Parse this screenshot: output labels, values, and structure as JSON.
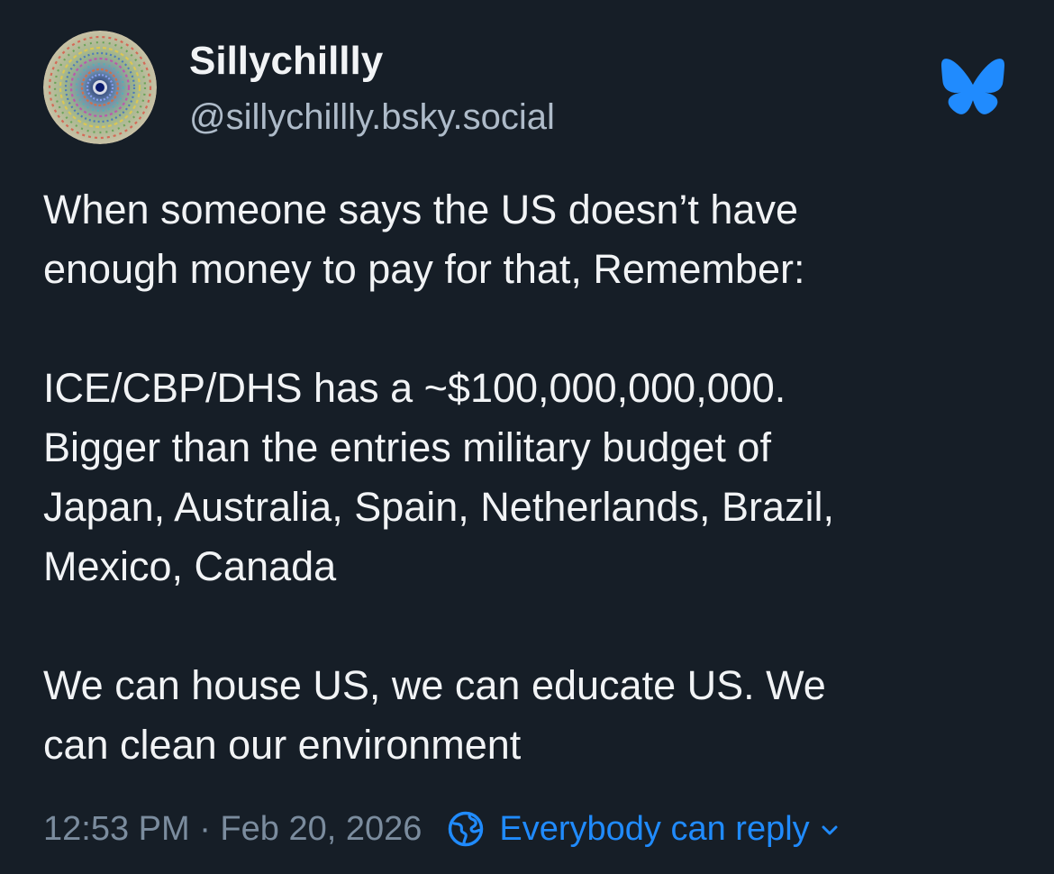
{
  "author": {
    "display_name": "Sillychillly",
    "handle": "@sillychillly.bsky.social",
    "avatar_icon": "swirl-avatar"
  },
  "brand": {
    "logo_icon": "bluesky-butterfly-icon",
    "color": "#208bfe"
  },
  "post": {
    "paragraphs": [
      "When someone says the US doesn’t have\nenough money to pay for that, Remember:",
      "ICE/CBP/DHS has a ~$100,000,000,000.\nBigger than the entries military budget of\nJapan, Australia, Spain, Netherlands, Brazil,\nMexico, Canada",
      "We can house US, we can educate US. We\ncan clean our environment"
    ]
  },
  "meta": {
    "timestamp": "12:53 PM · Feb 20, 2026",
    "reply_setting": "Everybody can reply",
    "reply_icon": "globe-icon"
  },
  "colors": {
    "background": "#161e27",
    "text": "#f1f3f5",
    "secondary_text": "#aebbc9",
    "muted_text": "#7b8c9e",
    "accent": "#208bfe"
  }
}
